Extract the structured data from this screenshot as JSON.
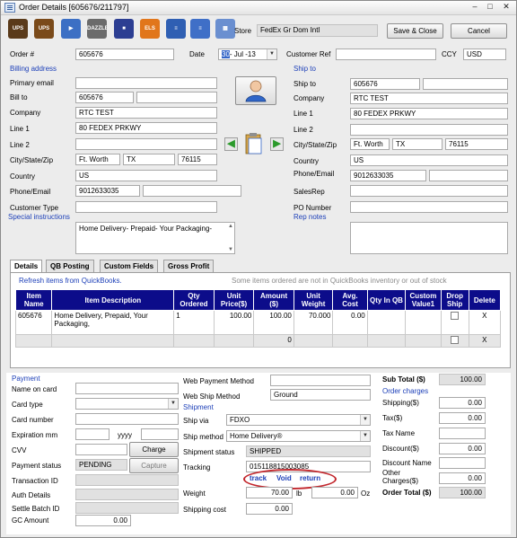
{
  "title": "Order Details [605676/211797]",
  "window_controls": {
    "minimize": "–",
    "maximize": "□",
    "close": "✕"
  },
  "toolbar": [
    {
      "name": "ups-icon",
      "label": "UPS",
      "color": "#5a3a1a"
    },
    {
      "name": "ups-void-icon",
      "label": "UPS",
      "color": "#7a4a1a"
    },
    {
      "name": "car-icon",
      "label": "▶",
      "color": "#3c6fc4"
    },
    {
      "name": "dazzle-icon",
      "label": "DAZZLE",
      "color": "#6b6b6b"
    },
    {
      "name": "box-icon",
      "label": "■",
      "color": "#2c3e92"
    },
    {
      "name": "els-icon",
      "label": "ELS",
      "color": "#e1761b"
    },
    {
      "name": "document-icon",
      "label": "≡",
      "color": "#2f5fb3"
    },
    {
      "name": "notes-icon",
      "label": "≡",
      "color": "#3f6fc7"
    },
    {
      "name": "grid-icon",
      "label": "▦",
      "color": "#6a8fd0"
    }
  ],
  "store": {
    "label": "Store",
    "value": "FedEx Gr Dom Intl"
  },
  "buttons": {
    "save_close": "Save & Close",
    "cancel": "Cancel",
    "charge": "Charge",
    "capture": "Capture"
  },
  "order": {
    "order_no_label": "Order #",
    "order_no": "605676",
    "date_label": "Date",
    "date_day": "30",
    "date_rest": "- Jul -13",
    "customer_ref_label": "Customer Ref",
    "customer_ref": "",
    "ccy_label": "CCY",
    "ccy": "USD"
  },
  "billing": {
    "section": "Billing address",
    "primary_email_label": "Primary email",
    "primary_email": "",
    "bill_to_label": "Bill to",
    "bill_to": "605676",
    "bill_to2": "",
    "company_label": "Company",
    "company": "RTC TEST",
    "line1_label": "Line 1",
    "line1": "80 FEDEX PRKWY",
    "line2_label": "Line 2",
    "line2": "",
    "csz_label": "City/State/Zip",
    "city": "Ft. Worth",
    "state": "TX",
    "zip": "76115",
    "country_label": "Country",
    "country": "US",
    "phone_label": "Phone/Email",
    "phone": "9012633035",
    "email": "",
    "customer_type_label": "Customer Type",
    "customer_type": ""
  },
  "shipping": {
    "section": "Ship to",
    "ship_to_label": "Ship to",
    "ship_to": "605676",
    "ship_to2": "",
    "company_label": "Company",
    "company": "RTC TEST",
    "line1_label": "Line 1",
    "line1": "80 FEDEX PRKWY",
    "line2_label": "Line 2",
    "line2": "",
    "csz_label": "City/State/Zip",
    "city": "Ft. Worth",
    "state": "TX",
    "zip": "76115",
    "country_label": "Country",
    "country": "US",
    "phone_label": "Phone/Email",
    "phone": "9012633035",
    "email": "",
    "salesrep_label": "SalesRep",
    "salesrep": "",
    "po_label": "PO Number",
    "po": ""
  },
  "special_instructions": {
    "label": "Special instructions",
    "text": "Home Delivery- Prepaid- Your Packaging-"
  },
  "rep_notes": {
    "label": "Rep notes",
    "text": ""
  },
  "tabs": [
    "Details",
    "QB Posting",
    "Custom Fields",
    "Gross Profit"
  ],
  "refresh_link": "Refresh items from QuickBooks.",
  "warning": "Some items ordered are not in QuickBooks inventory or out of stock",
  "grid": {
    "columns": [
      "Item Name",
      "Item Description",
      "Qty Ordered",
      "Unit Price($)",
      "Amount ($)",
      "Unit Weight",
      "Avg. Cost",
      "Qty In QB",
      "Custom Value1",
      "Drop Ship",
      "Delete"
    ],
    "rows": [
      {
        "item": "605676",
        "desc": "Home Delivery, Prepaid, Your Packaging,",
        "qty": "1",
        "price": "100.00",
        "amount": "100.00",
        "weight": "70.000",
        "cost": "0.00",
        "qb": "",
        "custom": "",
        "delete": "X"
      },
      {
        "item": "",
        "desc": "",
        "qty": "",
        "price": "",
        "amount": "0",
        "weight": "",
        "cost": "",
        "qb": "",
        "custom": "",
        "delete": "X"
      }
    ]
  },
  "payment": {
    "section": "Payment",
    "name_label": "Name on card",
    "name": "",
    "card_type_label": "Card type",
    "card_type": "",
    "card_number_label": "Card number",
    "card_number": "",
    "expiration_label": "Expiration mm",
    "exp_mm": "",
    "yyyy_label": "yyyy",
    "exp_yyyy": "",
    "cvv_label": "CVV",
    "cvv": "",
    "status_label": "Payment status",
    "status": "PENDING",
    "transaction_label": "Transaction ID",
    "transaction": "",
    "auth_label": "Auth Details",
    "auth": "",
    "settle_label": "Settle Batch ID",
    "settle": "",
    "gc_label": "GC Amount",
    "gc": "0.00"
  },
  "web": {
    "payment_method_label": "Web Payment Method",
    "payment_method": "",
    "ship_method_label": "Web Ship Method",
    "ship_method": "Ground"
  },
  "shipment": {
    "section": "Shipment",
    "ship_via_label": "Ship via",
    "ship_via": "FDXO",
    "ship_method_label": "Ship method",
    "ship_method": "Home Delivery®",
    "status_label": "Shipment status",
    "status": "SHIPPED",
    "tracking_label": "Tracking",
    "tracking": "015118815003085",
    "track": "track",
    "void": "Void",
    "return": "return",
    "weight_label": "Weight",
    "weight": "70.00",
    "lb": "lb",
    "oz_value": "0.00",
    "oz": "Oz",
    "cost_label": "Shipping cost",
    "cost": "0.00"
  },
  "totals": {
    "subtotal_label": "Sub Total ($)",
    "subtotal": "100.00",
    "charges_section": "Order charges",
    "shipping_label": "Shipping($)",
    "shipping": "0.00",
    "tax_label": "Tax($)",
    "tax": "0.00",
    "tax_name_label": "Tax Name",
    "tax_name": "",
    "discount_label": "Discount($)",
    "discount": "0.00",
    "discount_name_label": "Discount Name",
    "discount_name": "",
    "other_label": "Other Charges($)",
    "other": "0.00",
    "total_label": "Order Total ($)",
    "total": "100.00"
  },
  "colors": {
    "link": "#1c3fb8",
    "grid_header": "#0c0c8a",
    "highlight_oval": "#c2272d"
  }
}
